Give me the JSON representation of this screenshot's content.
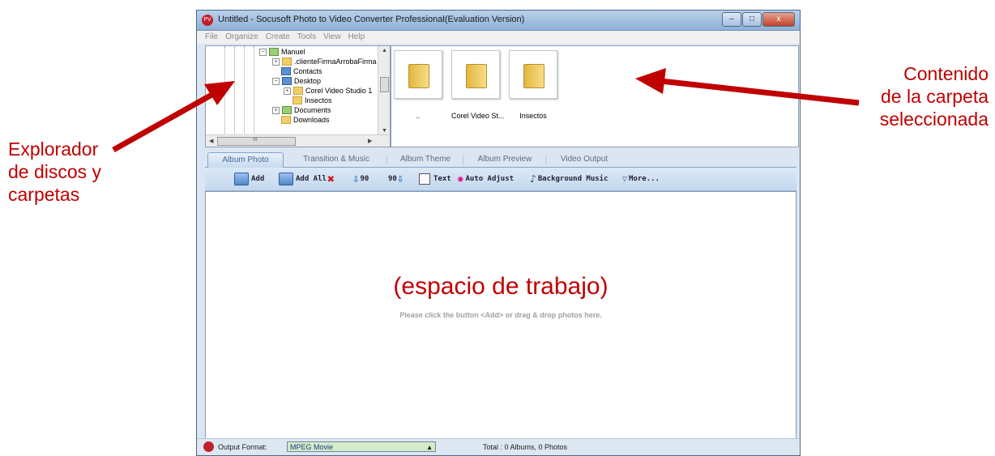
{
  "annotations": {
    "left": [
      "Explorador",
      "de discos y",
      "carpetas"
    ],
    "right": [
      "Contenido",
      "de la carpeta",
      "seleccionada"
    ],
    "workspace": "(espacio de trabajo)"
  },
  "window": {
    "title": "Untitled - Socusoft Photo to Video Converter Professional(Evaluation Version)",
    "controls": {
      "minimize": "–",
      "maximize": "□",
      "close": "x"
    }
  },
  "menu": [
    "File",
    "Organize",
    "Create",
    "Tools",
    "View",
    "Help"
  ],
  "tree": {
    "items": [
      {
        "label": "Manuel",
        "icon": "user-folder-icon",
        "expander": "−"
      },
      {
        "label": ".clienteFirmaArrobaFirma",
        "icon": "folder-icon",
        "expander": "+"
      },
      {
        "label": "Contacts",
        "icon": "contacts-folder-icon",
        "expander": ""
      },
      {
        "label": "Desktop",
        "icon": "desktop-folder-icon",
        "expander": "−"
      },
      {
        "label": "Corel Video Studio 1",
        "icon": "folder-icon",
        "expander": "+"
      },
      {
        "label": "Insectos",
        "icon": "folder-icon",
        "expander": ""
      },
      {
        "label": "Documents",
        "icon": "documents-folder-icon",
        "expander": "+"
      },
      {
        "label": "Downloads",
        "icon": "folder-icon",
        "expander": ""
      }
    ],
    "hscroll_thumb_text": "III"
  },
  "folder_contents": [
    {
      "label": "..",
      "icon": "folder-icon"
    },
    {
      "label": "Corel Video St...",
      "icon": "folder-icon"
    },
    {
      "label": "Insectos",
      "icon": "folder-icon"
    }
  ],
  "tabs": [
    "Album Photo",
    "Transition & Music",
    "Album Theme",
    "Album Preview",
    "Video Output"
  ],
  "active_tab": "Album Photo",
  "toolbar": {
    "add": "Add",
    "add_all": "Add All",
    "rotate_left": "90",
    "rotate_right": "90",
    "text": "Text",
    "auto_adjust": "Auto Adjust",
    "background_music": "Background Music",
    "more": "More..."
  },
  "workspace_hint": "Please click the button <Add> or drag & drop photos here.",
  "status": {
    "output_label": "Output Format:",
    "output_value": "MPEG Movie",
    "total": "Total : 0 Albums, 0 Photos"
  },
  "colors": {
    "annotation": "#c00000",
    "accent": "#7fa6cf",
    "format_bg": "#d5ebc7"
  }
}
